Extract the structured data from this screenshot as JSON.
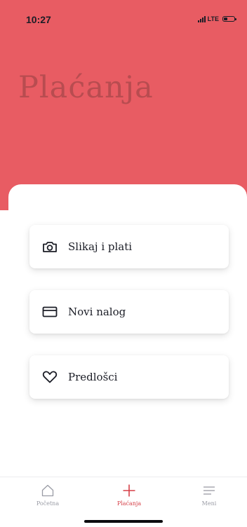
{
  "status_bar": {
    "time": "10:27",
    "network": "LTE",
    "battery_level": 0.35
  },
  "header": {
    "title": "Plaćanja",
    "background_color": "#e85c63"
  },
  "actions": [
    {
      "label": "Slikaj i plati",
      "icon": "camera-icon"
    },
    {
      "label": "Novi nalog",
      "icon": "card-icon"
    },
    {
      "label": "Predlošci",
      "icon": "heart-icon"
    }
  ],
  "tab_bar": {
    "items": [
      {
        "label": "Početna",
        "icon": "home-icon",
        "active": false
      },
      {
        "label": "Plaćanja",
        "icon": "plus-icon",
        "active": true
      },
      {
        "label": "Meni",
        "icon": "menu-icon",
        "active": false
      }
    ],
    "active_color": "#d53f47",
    "inactive_color": "#9a9ca5"
  }
}
